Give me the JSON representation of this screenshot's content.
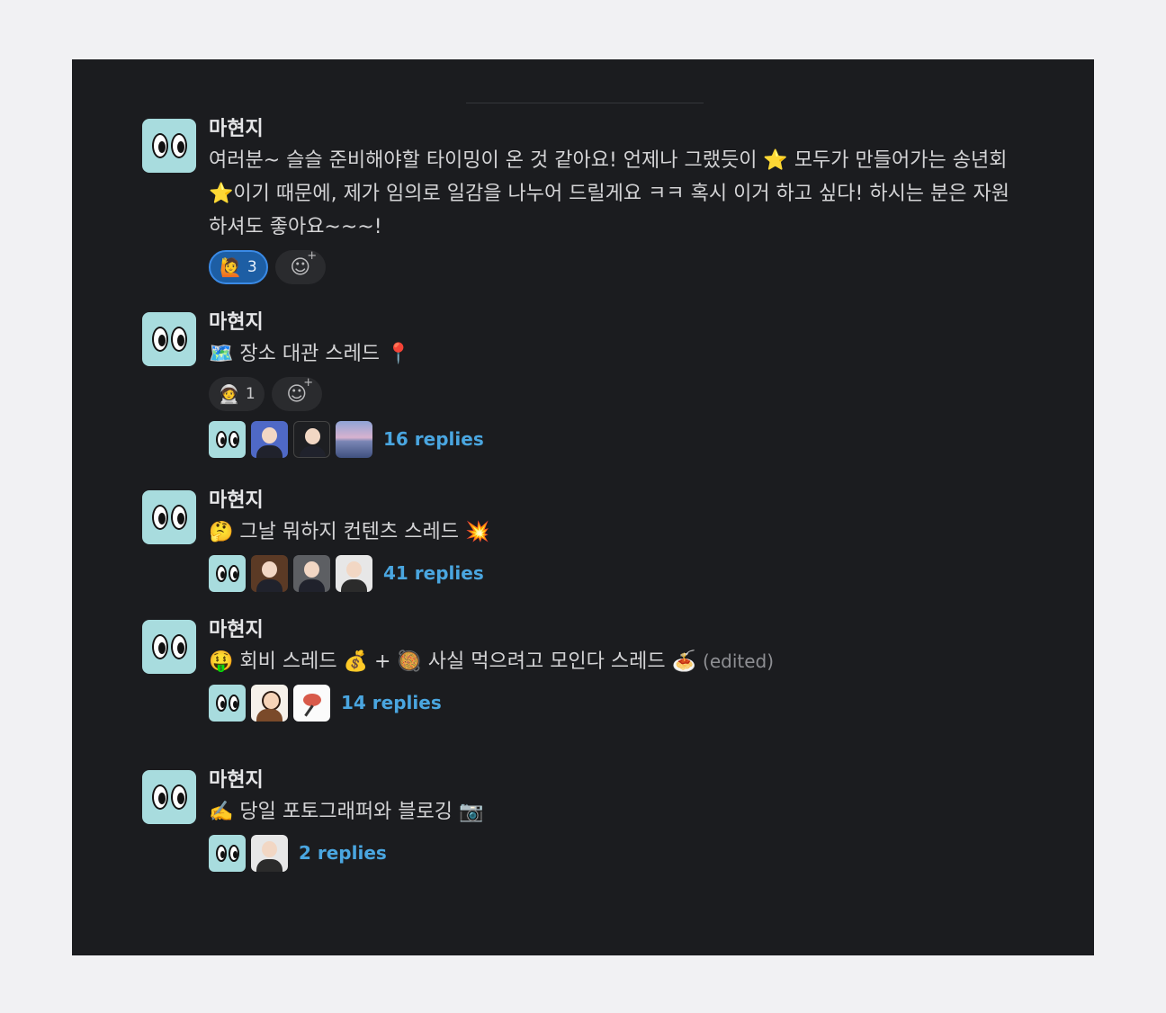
{
  "messages": [
    {
      "author": "마현지",
      "text": "여러분~ 슬슬 준비해야할 타이밍이 온 것 같아요! 언제나 그랬듯이 ⭐️ 모두가 만들어가는 송년회⭐️이기 때문에, 제가 임의로 일감을 나누어 드릴게요 ㅋㅋ 혹시 이거 하고 싶다! 하시는 분은 자원하셔도 좋아요~~~!",
      "reactions": [
        {
          "emoji": "🙋",
          "count": "3",
          "active": true
        }
      ]
    },
    {
      "author": "마현지",
      "text": "🗺️ 장소 대관 스레드 📍",
      "reactions": [
        {
          "emoji": "🧑‍🚀",
          "count": "1",
          "active": false
        }
      ],
      "replies": "16 replies"
    },
    {
      "author": "마현지",
      "text": "🤔 그날 뭐하지 컨텐츠 스레드 💥",
      "replies": "41 replies"
    },
    {
      "author": "마현지",
      "text": "🤑 회비 스레드 💰 + 🥘 사실 먹으려고 모인다 스레드 🍝",
      "edited": "(edited)",
      "replies": "14 replies"
    },
    {
      "author": "마현지",
      "text": "✍️ 당일 포토그래퍼와 블로깅 📷",
      "replies": "2 replies"
    }
  ],
  "icons": {
    "avatar": "googly-eyes-icon",
    "add_reaction": "add-reaction-icon"
  },
  "colors": {
    "background": "#1b1c1f",
    "link": "#4aa6e0",
    "reaction_active": "#1d5ea4"
  }
}
